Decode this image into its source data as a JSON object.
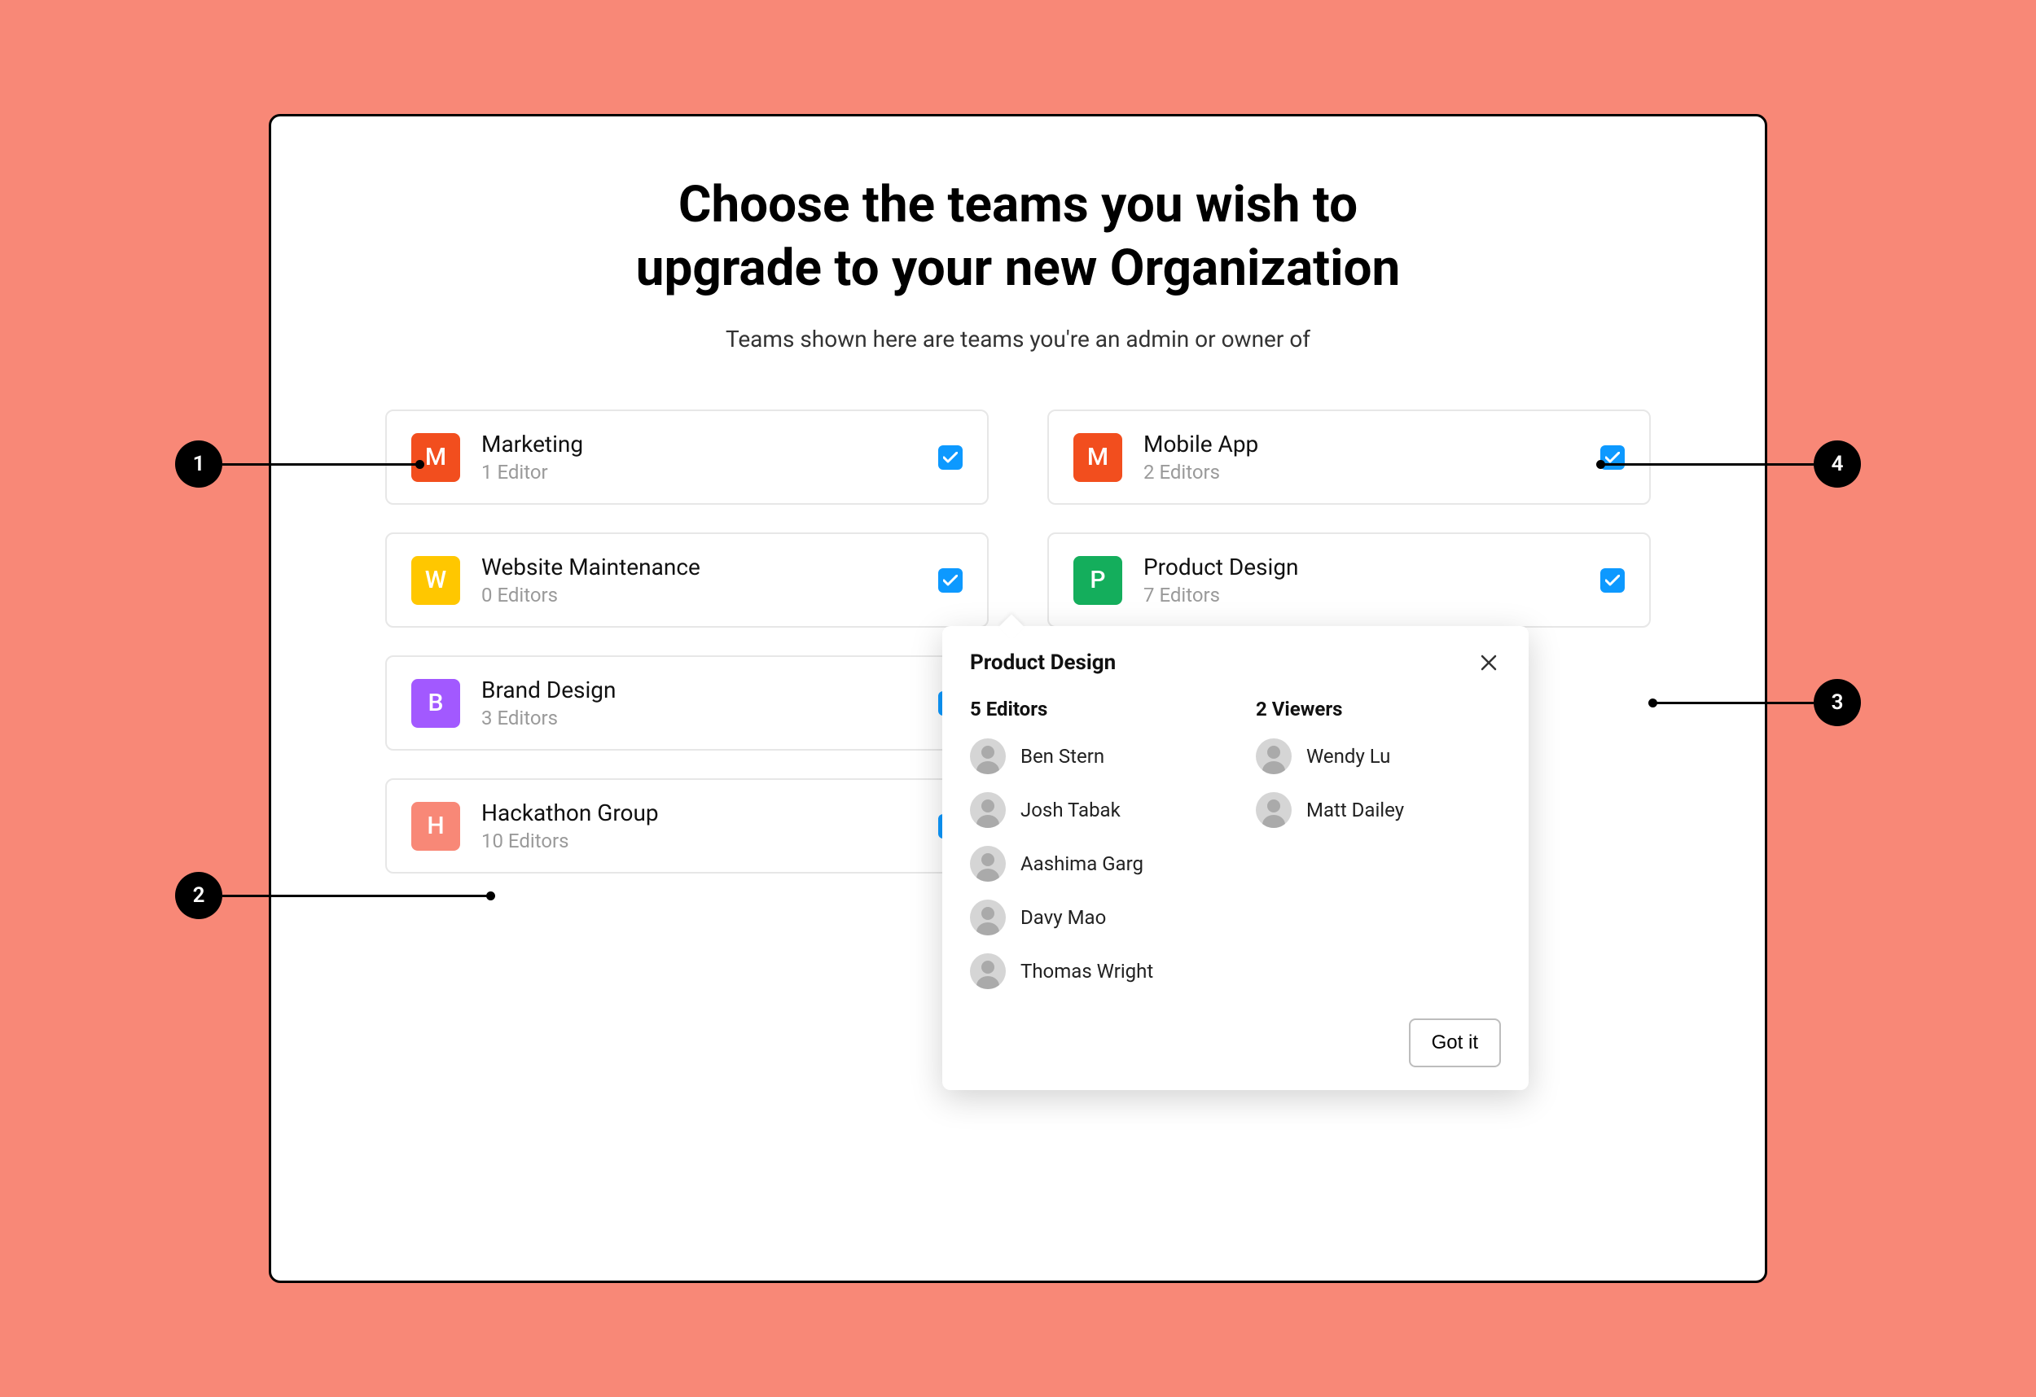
{
  "title_line1": "Choose the teams you wish to",
  "title_line2": "upgrade to your new Organization",
  "subtitle": "Teams shown here are teams you're an admin or owner of",
  "teams": [
    {
      "letter": "M",
      "color": "#f24e1e",
      "name": "Marketing",
      "subtitle": "1 Editor",
      "checked": true
    },
    {
      "letter": "M",
      "color": "#f24e1e",
      "name": "Mobile App",
      "subtitle": "2 Editors",
      "checked": true
    },
    {
      "letter": "W",
      "color": "#ffc700",
      "name": "Website Maintenance",
      "subtitle": "0 Editors",
      "checked": true
    },
    {
      "letter": "P",
      "color": "#14ae5c",
      "name": "Product Design",
      "subtitle": "7 Editors",
      "checked": true
    },
    {
      "letter": "B",
      "color": "#a259ff",
      "name": "Brand Design",
      "subtitle": "3 Editors",
      "checked": true
    },
    {
      "letter": "H",
      "color": "#f88877",
      "name": "Hackathon Group",
      "subtitle": "10 Editors",
      "checked": true
    }
  ],
  "popover": {
    "title": "Product Design",
    "editors_heading": "5 Editors",
    "viewers_heading": "2 Viewers",
    "editors": [
      {
        "name": "Ben Stern"
      },
      {
        "name": "Josh Tabak"
      },
      {
        "name": "Aashima Garg"
      },
      {
        "name": "Davy Mao"
      },
      {
        "name": "Thomas Wright"
      }
    ],
    "viewers": [
      {
        "name": "Wendy Lu"
      },
      {
        "name": "Matt Dailey"
      }
    ],
    "button": "Got it"
  },
  "callouts": {
    "one": "1",
    "two": "2",
    "three": "3",
    "four": "4"
  },
  "colors": {
    "background": "#f88877",
    "checkbox": "#0d99ff"
  }
}
